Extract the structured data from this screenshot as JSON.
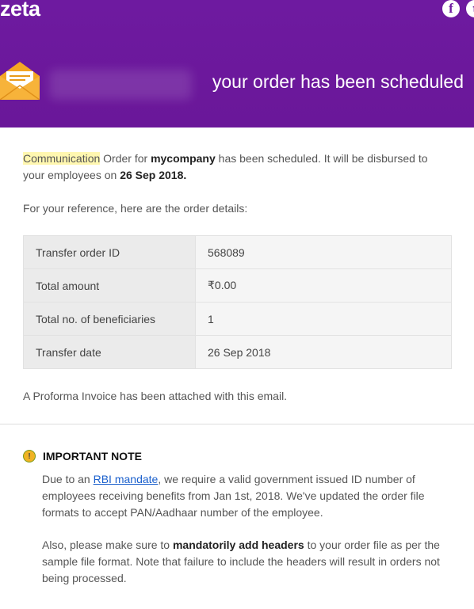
{
  "header": {
    "logo": "zeta",
    "headline": "your order has been scheduled",
    "social": [
      {
        "icon": "facebook-icon",
        "glyph": "f"
      },
      {
        "icon": "twitter-icon",
        "glyph": "t"
      }
    ],
    "brand_color": "#6e1aa0"
  },
  "intro": {
    "highlight": "Communication",
    "part1": " Order for ",
    "company": "mycompany",
    "part2": " has been scheduled. It will be disbursed to your employees on ",
    "date": "26 Sep 2018."
  },
  "reference_text": "For your reference, here are the order details:",
  "details": [
    {
      "label": "Transfer order ID",
      "value": "568089"
    },
    {
      "label": "Total amount",
      "value": "₹0.00"
    },
    {
      "label": "Total no. of beneficiaries",
      "value": "1"
    },
    {
      "label": "Transfer date",
      "value": "26 Sep 2018"
    }
  ],
  "proforma_text": "A Proforma Invoice has been attached with this email.",
  "note": {
    "icon": "info-icon",
    "icon_glyph": "!",
    "title": "IMPORTANT NOTE",
    "p1_before": "Due to an ",
    "p1_link": "RBI mandate",
    "p1_after": ", we require a valid government issued ID number of employees receiving benefits from Jan 1st, 2018. We've updated the order file formats to accept PAN/Aadhaar number of the employee.",
    "p2_before": "Also, please make sure to ",
    "p2_bold": "mandatorily add headers",
    "p2_after": " to your order file as per the sample file format. Note that failure to include the headers will result in orders not being processed."
  }
}
